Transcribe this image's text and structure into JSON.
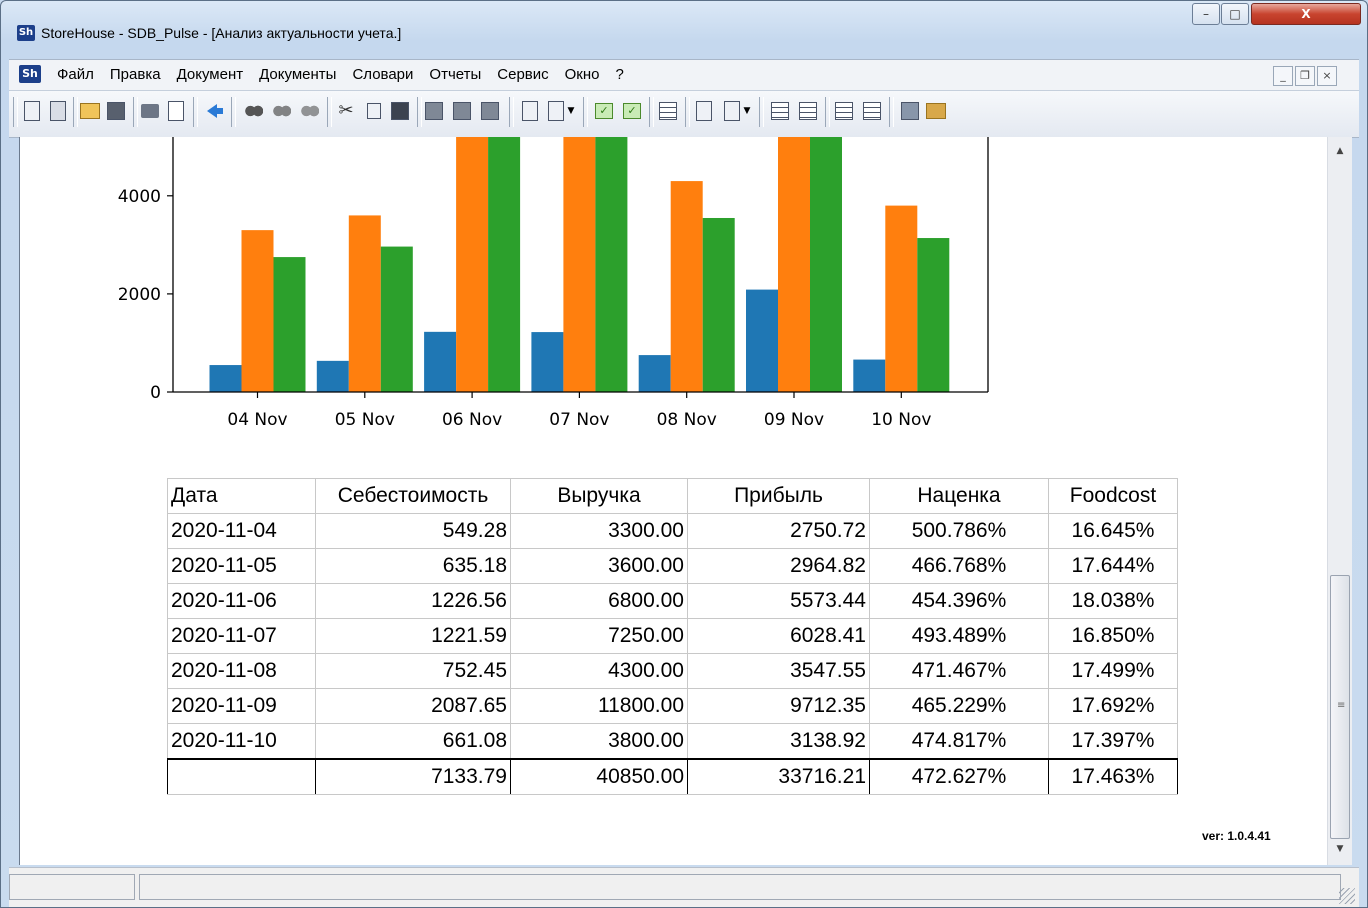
{
  "window": {
    "title": "StoreHouse - SDB_Pulse - [Анализ актуальности учета.]",
    "app_icon_text": "Sh",
    "minimize_label": "–",
    "maximize_label": "□",
    "close_label": "X"
  },
  "menu": {
    "icon_text": "Sh",
    "items": [
      "Файл",
      "Правка",
      "Документ",
      "Документы",
      "Словари",
      "Отчеты",
      "Сервис",
      "Окно",
      "?"
    ],
    "mdi_minimize": "_",
    "mdi_restore": "❐",
    "mdi_close": "×"
  },
  "toolbar": {
    "icons": [
      "document-icon",
      "document-settings-icon",
      "open-folder-icon",
      "save-icon",
      "print-icon",
      "print-preview-icon",
      "back-arrow-icon",
      "find-icon",
      "find-next-icon",
      "replace-icon",
      "cut-icon",
      "copy-icon",
      "paste-icon",
      "block-icon",
      "block-2-icon",
      "block-3-icon",
      "doc-list-icon",
      "doc-dropdown-icon",
      "check-icon",
      "check-2-icon",
      "grid-icon",
      "clipboard-icon",
      "clipboard-add-icon",
      "table-icon",
      "table-add-icon",
      "table-2-icon",
      "table-3-icon",
      "bars-icon",
      "boxes-icon"
    ]
  },
  "chart_data": {
    "type": "bar",
    "categories": [
      "04 Nov",
      "05 Nov",
      "06 Nov",
      "07 Nov",
      "08 Nov",
      "09 Nov",
      "10 Nov"
    ],
    "series": [
      {
        "values": [
          549.28,
          635.18,
          1226.56,
          1221.59,
          752.45,
          2087.65,
          661.08
        ],
        "color": "#1f77b4"
      },
      {
        "values": [
          3300.0,
          3600.0,
          6800.0,
          7250.0,
          4300.0,
          11800.0,
          3800.0
        ],
        "color": "#ff7f0e"
      },
      {
        "values": [
          2750.72,
          2964.82,
          5573.44,
          6028.41,
          3547.55,
          9712.35,
          3138.92
        ],
        "color": "#2ca02c"
      }
    ],
    "yticks": [
      0,
      2000,
      4000
    ],
    "ylim_visible": [
      0,
      5000
    ],
    "grid": false,
    "legend": "none"
  },
  "table": {
    "headers": [
      "Дата",
      "Себестоимость",
      "Выручка",
      "Прибыль",
      "Наценка",
      "Foodcost"
    ],
    "rows": [
      [
        "2020-11-04",
        "549.28",
        "3300.00",
        "2750.72",
        "500.786%",
        "16.645%"
      ],
      [
        "2020-11-05",
        "635.18",
        "3600.00",
        "2964.82",
        "466.768%",
        "17.644%"
      ],
      [
        "2020-11-06",
        "1226.56",
        "6800.00",
        "5573.44",
        "454.396%",
        "18.038%"
      ],
      [
        "2020-11-07",
        "1221.59",
        "7250.00",
        "6028.41",
        "493.489%",
        "16.850%"
      ],
      [
        "2020-11-08",
        "752.45",
        "4300.00",
        "3547.55",
        "471.467%",
        "17.499%"
      ],
      [
        "2020-11-09",
        "2087.65",
        "11800.00",
        "9712.35",
        "465.229%",
        "17.692%"
      ],
      [
        "2020-11-10",
        "661.08",
        "3800.00",
        "3138.92",
        "474.817%",
        "17.397%"
      ]
    ],
    "total": [
      "",
      "7133.79",
      "40850.00",
      "33716.21",
      "472.627%",
      "17.463%"
    ]
  },
  "version_text": "ver: 1.0.4.41",
  "statusbar": {
    "panel1": "",
    "panel2": ""
  }
}
